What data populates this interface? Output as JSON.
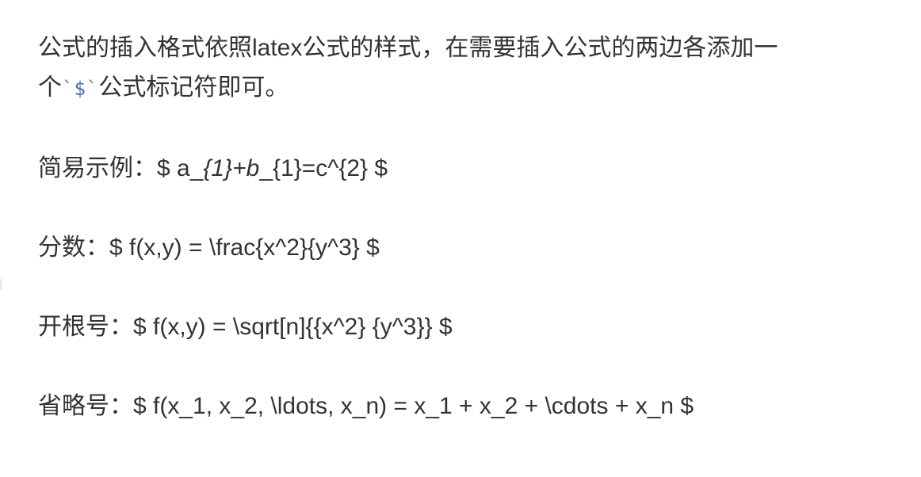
{
  "intro": {
    "line1": "公式的插入格式依照latex公式的样式，在需要插入公式的两边各添加一",
    "line2_prefix": "个",
    "tick_left": "`",
    "dollar": "$",
    "tick_right": "`",
    "line2_suffix": "公式标记符即可。"
  },
  "examples": [
    {
      "label": "简易示例：",
      "pre": "$ a_",
      "em1": "{1}+b",
      "post": "_{1}=c^{2} $"
    },
    {
      "label": "分数：",
      "formula": "$ f(x,y) = \\frac{x^2}{y^3} $"
    },
    {
      "label": "开根号：",
      "formula": "$ f(x,y) = \\sqrt[n]{{x^2} {y^3}} $"
    },
    {
      "label": "省略号：",
      "formula": "$ f(x_1, x_2, \\ldots, x_n) = x_1 + x_2 + \\cdots + x_n $"
    }
  ]
}
